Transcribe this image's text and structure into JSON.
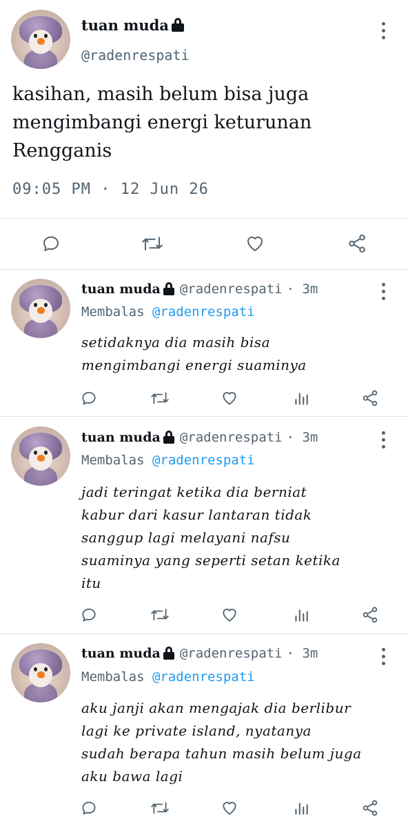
{
  "main_tweet": {
    "name": "tuan muda",
    "handle": "@radenrespati",
    "text": "kasihan, masih belum bisa juga\nmengimbangi energi keturunan\nRengganis",
    "timestamp": "09:05 PM · 12 Jun 26",
    "actions": [
      "reply-icon",
      "retweet-icon",
      "like-icon",
      "share-icon"
    ]
  },
  "replies": [
    {
      "name": "tuan muda",
      "handle": "@radenrespati",
      "time": "· 3m",
      "reply_label": "Membalas",
      "reply_to": "@radenrespati",
      "text": "setidaknya dia masih bisa\nmengimbangi energi suaminya"
    },
    {
      "name": "tuan muda",
      "handle": "@radenrespati",
      "time": "· 3m",
      "reply_label": "Membalas",
      "reply_to": "@radenrespati",
      "text": "jadi teringat ketika dia berniat\nkabur dari kasur lantaran tidak\nsanggup lagi melayani nafsu\nsuaminya yang seperti setan ketika\nitu"
    },
    {
      "name": "tuan muda",
      "handle": "@radenrespati",
      "time": "· 3m",
      "reply_label": "Membalas",
      "reply_to": "@radenrespati",
      "text": "aku janji akan mengajak dia berlibur\nlagi ke private island, nyatanya\nsudah berapa tahun masih belum juga\naku bawa lagi"
    }
  ],
  "colors": {
    "text": "#0f1419",
    "muted": "#536471",
    "mention": "#1d9bf0",
    "divider": "#dfe3e6"
  }
}
